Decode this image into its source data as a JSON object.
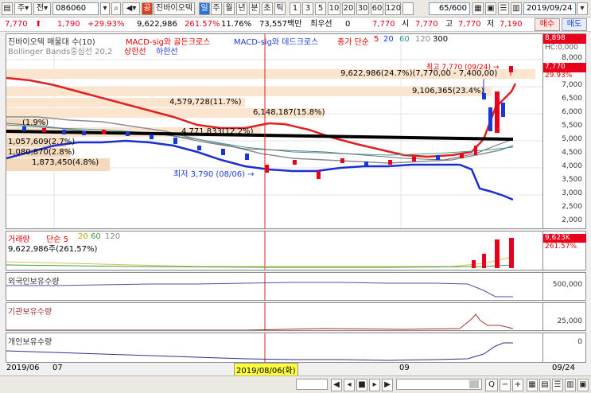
{
  "toolbar": {
    "code": "086060",
    "type_label": "주",
    "sel_label": "전",
    "stock_name": "진바이오텍",
    "badge": "공",
    "badge2": "일",
    "periods": [
      "주",
      "월",
      "년",
      "분",
      "초",
      "틱"
    ],
    "minutes": [
      "1",
      "3",
      "5",
      "10",
      "20",
      "30",
      "60",
      "120"
    ],
    "count": "65/600",
    "date": "2019/09/24"
  },
  "price_row": {
    "price": "7,770",
    "change": "1,790",
    "change_pct": "+29.93%",
    "volume": "9,622,986",
    "vol_pct": "261.57%",
    "turnover": "11.76%",
    "amount": "73,557백만",
    "prefer_label": "최우선",
    "prefer_value": "0",
    "open_price": "7,770",
    "open_label": "시",
    "open_value": "7,770",
    "high_label": "고",
    "high_value": "7,770",
    "low_label": "저",
    "low_value": "7,190",
    "buy": "매수",
    "sell": "매도"
  },
  "main_chart": {
    "legend": {
      "title": "진바이오텍 매물대 수(10)",
      "macd1": "MACD-sig와 골든크로스",
      "macd2": "MACD-sig와 데드크로스",
      "ma": "종가 단순",
      "ma_periods": [
        "5",
        "20",
        "60",
        "120",
        "300"
      ],
      "bollinger": "Bollinger Bands중심선 20,2",
      "upper": "상한선",
      "lower": "하한선"
    },
    "price_axis": [
      "8,000",
      "7,500",
      "7,000",
      "6,500",
      "6,000",
      "5,500",
      "5,000",
      "4,500",
      "4,000",
      "3,500",
      "3,000",
      "2,500",
      "2,000"
    ],
    "price_tags": {
      "top": "8,898",
      "current": "7,770",
      "pct": "29.93%",
      "hc": "HC:0,000"
    },
    "volume_profile": [
      {
        "label": "9,622,986(24.7%)(7,770,00 - 7,400,00)"
      },
      {
        "label": "9,106,365(23.4%)"
      },
      {
        "label": "4,579,728(11.7%)"
      },
      {
        "label": "6,148,187(15.8%)"
      },
      {
        "label": "(1.9%)"
      },
      {
        "label": "4,771,833(12.2%)"
      },
      {
        "label": "1,057,609(2.7%)"
      },
      {
        "label": "1,080,870(2.8%)"
      },
      {
        "label": "1,873,450(4.8%)"
      }
    ],
    "high_annotation": "최고 7,770 (09/24) →",
    "low_annotation": "최저 3,790 (08/06) →",
    "candle_colors": {
      "up": "#e8001c",
      "down": "#1538d6"
    }
  },
  "volume_panel": {
    "label": "거래량",
    "ma_label": "단순 5",
    "ma_periods": [
      "20",
      "60",
      "120"
    ],
    "value_label": "9,622,986주(261,57%)",
    "axis_tags": {
      "value": "9,623K",
      "pct": "261.57%"
    }
  },
  "foreign_panel": {
    "label": "외국인보유수량",
    "tick": "500,000"
  },
  "inst_panel": {
    "label": "기관보유수량",
    "tick": "25,000"
  },
  "indiv_panel": {
    "label": "개인보유수량",
    "tick": "0"
  },
  "time_axis": {
    "start": "2019/06",
    "m07": "07",
    "m09": "09",
    "cursor_date": "2019/08/06(화)",
    "end": "09/24"
  }
}
